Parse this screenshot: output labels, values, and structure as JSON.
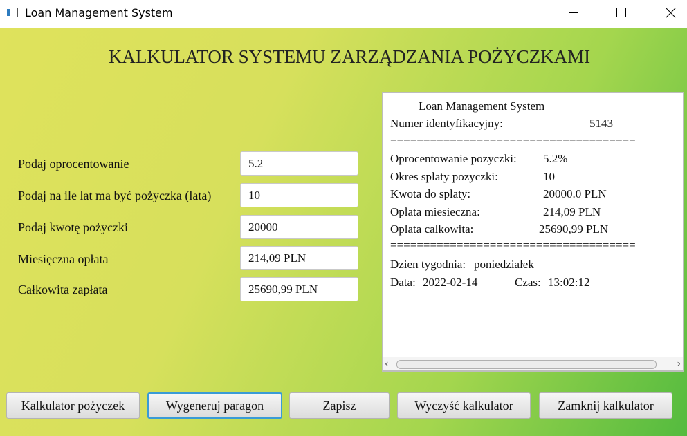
{
  "window": {
    "title": "Loan Management System"
  },
  "main": {
    "heading": "KALKULATOR SYSTEMU ZARZĄDZANIA POŻYCZKAMI",
    "fields": [
      {
        "label": "Podaj oprocentowanie",
        "value": "5.2"
      },
      {
        "label": "Podaj na ile lat ma być pożyczka (lata)",
        "value": "10"
      },
      {
        "label": "Podaj kwotę pożyczki",
        "value": "20000"
      },
      {
        "label": "Miesięczna opłata",
        "value": "214,09 PLN"
      },
      {
        "label": "Całkowita zapłata",
        "value": "25690,99 PLN"
      }
    ]
  },
  "receipt": {
    "title": "Loan Management System",
    "id_label": "Numer identyfikacyjny:",
    "id_value": "5143",
    "separator": "=====================================",
    "rate_label": "Oprocentowanie pozyczki:",
    "rate_value": "5.2%",
    "period_label": "Okres splaty pozyczki:",
    "period_value": "10",
    "amount_label": "Kwota do splaty:",
    "amount_value": "20000.0 PLN",
    "monthly_label": "Oplata miesieczna:",
    "monthly_value": "214,09 PLN",
    "total_label": "Oplata calkowita:",
    "total_value": "25690,99 PLN",
    "weekday_label": "Dzien tygodnia:",
    "weekday_value": "poniedziałek",
    "date_label": "Data:",
    "date_value": "2022-02-14",
    "time_label": "Czas:",
    "time_value": "13:02:12"
  },
  "buttons": {
    "calculator": "Kalkulator pożyczek",
    "generate": "Wygeneruj paragon",
    "save": "Zapisz",
    "clear": "Wyczyść kalkulator",
    "close": "Zamknij kalkulator"
  },
  "icons": {
    "app": "app-window-icon",
    "minimize": "minimize-icon",
    "maximize": "maximize-icon",
    "close": "close-icon",
    "scroll_left": "scroll-left-arrow",
    "scroll_right": "scroll-right-arrow"
  },
  "colors": {
    "gradient_start": "#dfe25c",
    "gradient_end": "#54bb3f",
    "focus": "#3a9bd6"
  }
}
